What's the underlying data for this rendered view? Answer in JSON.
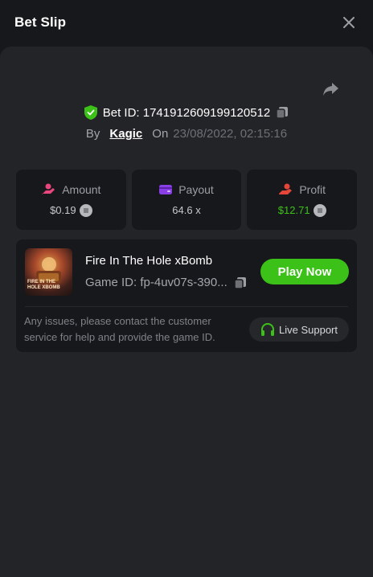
{
  "header": {
    "title": "Bet Slip",
    "close_icon": "close-icon"
  },
  "bet": {
    "id_label": "Bet ID: 1741912609199120512",
    "by_label": "By",
    "user": "Kagic",
    "on_label": "On",
    "date": "23/08/2022, 02:15:16"
  },
  "stats": {
    "amount": {
      "label": "Amount",
      "value": "$0.19",
      "icon": "amount-icon",
      "color": "#e8467c"
    },
    "payout": {
      "label": "Payout",
      "value": "64.6 x",
      "icon": "wallet-icon",
      "color": "#8a3fe6"
    },
    "profit": {
      "label": "Profit",
      "value": "$12.71",
      "icon": "profit-icon",
      "color": "#e5463a",
      "value_color": "#3bc117"
    }
  },
  "game": {
    "name": "Fire In The Hole xBomb",
    "id": "Game ID: fp-4uv07s-390...",
    "thumb_text": "FIRE IN THE HOLE XBOMB",
    "play_label": "Play Now"
  },
  "support": {
    "note": "Any issues, please contact the customer service for help and provide the game ID.",
    "button_label": "Live Support"
  },
  "colors": {
    "accent_green": "#3bc117",
    "background": "#17181b",
    "panel": "#232427"
  }
}
